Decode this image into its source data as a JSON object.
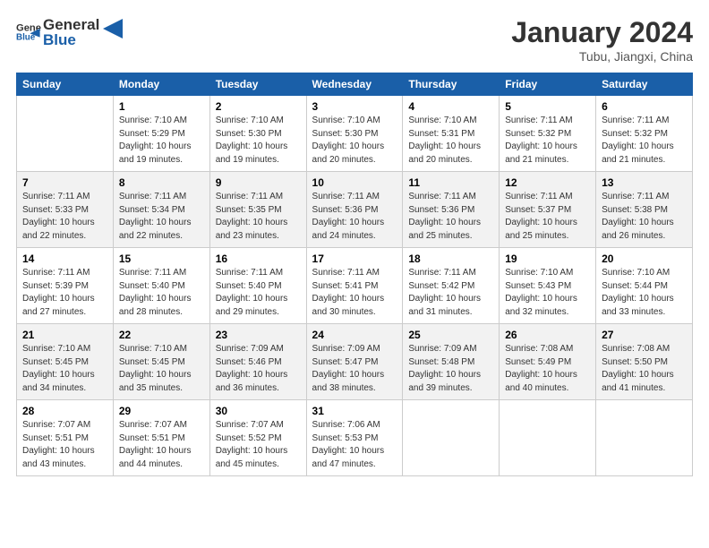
{
  "header": {
    "logo_general": "General",
    "logo_blue": "Blue",
    "month_title": "January 2024",
    "location": "Tubu, Jiangxi, China"
  },
  "days_of_week": [
    "Sunday",
    "Monday",
    "Tuesday",
    "Wednesday",
    "Thursday",
    "Friday",
    "Saturday"
  ],
  "weeks": [
    [
      {
        "day": "",
        "info": ""
      },
      {
        "day": "1",
        "info": "Sunrise: 7:10 AM\nSunset: 5:29 PM\nDaylight: 10 hours\nand 19 minutes."
      },
      {
        "day": "2",
        "info": "Sunrise: 7:10 AM\nSunset: 5:30 PM\nDaylight: 10 hours\nand 19 minutes."
      },
      {
        "day": "3",
        "info": "Sunrise: 7:10 AM\nSunset: 5:30 PM\nDaylight: 10 hours\nand 20 minutes."
      },
      {
        "day": "4",
        "info": "Sunrise: 7:10 AM\nSunset: 5:31 PM\nDaylight: 10 hours\nand 20 minutes."
      },
      {
        "day": "5",
        "info": "Sunrise: 7:11 AM\nSunset: 5:32 PM\nDaylight: 10 hours\nand 21 minutes."
      },
      {
        "day": "6",
        "info": "Sunrise: 7:11 AM\nSunset: 5:32 PM\nDaylight: 10 hours\nand 21 minutes."
      }
    ],
    [
      {
        "day": "7",
        "info": "Sunrise: 7:11 AM\nSunset: 5:33 PM\nDaylight: 10 hours\nand 22 minutes."
      },
      {
        "day": "8",
        "info": "Sunrise: 7:11 AM\nSunset: 5:34 PM\nDaylight: 10 hours\nand 22 minutes."
      },
      {
        "day": "9",
        "info": "Sunrise: 7:11 AM\nSunset: 5:35 PM\nDaylight: 10 hours\nand 23 minutes."
      },
      {
        "day": "10",
        "info": "Sunrise: 7:11 AM\nSunset: 5:36 PM\nDaylight: 10 hours\nand 24 minutes."
      },
      {
        "day": "11",
        "info": "Sunrise: 7:11 AM\nSunset: 5:36 PM\nDaylight: 10 hours\nand 25 minutes."
      },
      {
        "day": "12",
        "info": "Sunrise: 7:11 AM\nSunset: 5:37 PM\nDaylight: 10 hours\nand 25 minutes."
      },
      {
        "day": "13",
        "info": "Sunrise: 7:11 AM\nSunset: 5:38 PM\nDaylight: 10 hours\nand 26 minutes."
      }
    ],
    [
      {
        "day": "14",
        "info": "Sunrise: 7:11 AM\nSunset: 5:39 PM\nDaylight: 10 hours\nand 27 minutes."
      },
      {
        "day": "15",
        "info": "Sunrise: 7:11 AM\nSunset: 5:40 PM\nDaylight: 10 hours\nand 28 minutes."
      },
      {
        "day": "16",
        "info": "Sunrise: 7:11 AM\nSunset: 5:40 PM\nDaylight: 10 hours\nand 29 minutes."
      },
      {
        "day": "17",
        "info": "Sunrise: 7:11 AM\nSunset: 5:41 PM\nDaylight: 10 hours\nand 30 minutes."
      },
      {
        "day": "18",
        "info": "Sunrise: 7:11 AM\nSunset: 5:42 PM\nDaylight: 10 hours\nand 31 minutes."
      },
      {
        "day": "19",
        "info": "Sunrise: 7:10 AM\nSunset: 5:43 PM\nDaylight: 10 hours\nand 32 minutes."
      },
      {
        "day": "20",
        "info": "Sunrise: 7:10 AM\nSunset: 5:44 PM\nDaylight: 10 hours\nand 33 minutes."
      }
    ],
    [
      {
        "day": "21",
        "info": "Sunrise: 7:10 AM\nSunset: 5:45 PM\nDaylight: 10 hours\nand 34 minutes."
      },
      {
        "day": "22",
        "info": "Sunrise: 7:10 AM\nSunset: 5:45 PM\nDaylight: 10 hours\nand 35 minutes."
      },
      {
        "day": "23",
        "info": "Sunrise: 7:09 AM\nSunset: 5:46 PM\nDaylight: 10 hours\nand 36 minutes."
      },
      {
        "day": "24",
        "info": "Sunrise: 7:09 AM\nSunset: 5:47 PM\nDaylight: 10 hours\nand 38 minutes."
      },
      {
        "day": "25",
        "info": "Sunrise: 7:09 AM\nSunset: 5:48 PM\nDaylight: 10 hours\nand 39 minutes."
      },
      {
        "day": "26",
        "info": "Sunrise: 7:08 AM\nSunset: 5:49 PM\nDaylight: 10 hours\nand 40 minutes."
      },
      {
        "day": "27",
        "info": "Sunrise: 7:08 AM\nSunset: 5:50 PM\nDaylight: 10 hours\nand 41 minutes."
      }
    ],
    [
      {
        "day": "28",
        "info": "Sunrise: 7:07 AM\nSunset: 5:51 PM\nDaylight: 10 hours\nand 43 minutes."
      },
      {
        "day": "29",
        "info": "Sunrise: 7:07 AM\nSunset: 5:51 PM\nDaylight: 10 hours\nand 44 minutes."
      },
      {
        "day": "30",
        "info": "Sunrise: 7:07 AM\nSunset: 5:52 PM\nDaylight: 10 hours\nand 45 minutes."
      },
      {
        "day": "31",
        "info": "Sunrise: 7:06 AM\nSunset: 5:53 PM\nDaylight: 10 hours\nand 47 minutes."
      },
      {
        "day": "",
        "info": ""
      },
      {
        "day": "",
        "info": ""
      },
      {
        "day": "",
        "info": ""
      }
    ]
  ]
}
